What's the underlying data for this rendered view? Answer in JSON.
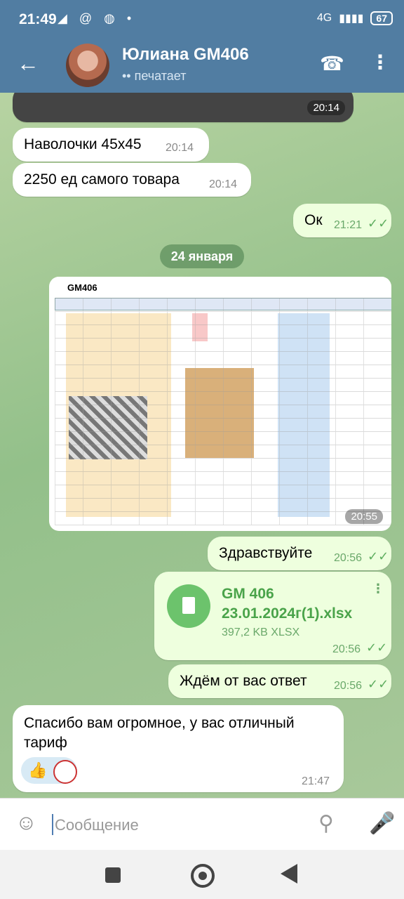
{
  "status_bar": {
    "time": "21:49",
    "indicators": "◢ @ ◍ •",
    "network": "4G",
    "battery": "67"
  },
  "header": {
    "title": "Юлиана GM406",
    "subtitle": "•• печатает"
  },
  "messages": {
    "photo_time": "20:14",
    "m1": {
      "text": "Наволочки 45x45",
      "time": "20:14"
    },
    "m2": {
      "text": "2250 ед самого товара",
      "time": "20:14"
    },
    "m3": {
      "text": "Ок",
      "time": "21:21"
    },
    "date_divider": "24 января",
    "sheet_photo": {
      "time": "20:55",
      "title": "GM406"
    },
    "m5": {
      "text": "Здравствуйте",
      "time": "20:56"
    },
    "file": {
      "name": "GM 406 23.01.2024г(1).xlsx",
      "size": "397,2 KB XLSX",
      "time": "20:56"
    },
    "m7": {
      "text": "Ждём от вас ответ",
      "time": "20:56"
    },
    "m8": {
      "text": "Спасибо вам огромное, у вас отличный тариф",
      "time": "21:47",
      "reaction": "👍"
    }
  },
  "input": {
    "placeholder": "Сообщение"
  },
  "icons": {
    "back": "back-arrow-icon",
    "phone": "phone-icon",
    "menu": "more-vert-icon",
    "emoji": "emoji-icon",
    "attach": "paperclip-icon",
    "mic": "mic-icon",
    "file": "file-icon",
    "read": "double-check-icon"
  },
  "colors": {
    "header": "#517da2",
    "outgoing_bubble": "#eeffde",
    "incoming_bubble": "#ffffff",
    "accent_green": "#4aa34a"
  }
}
